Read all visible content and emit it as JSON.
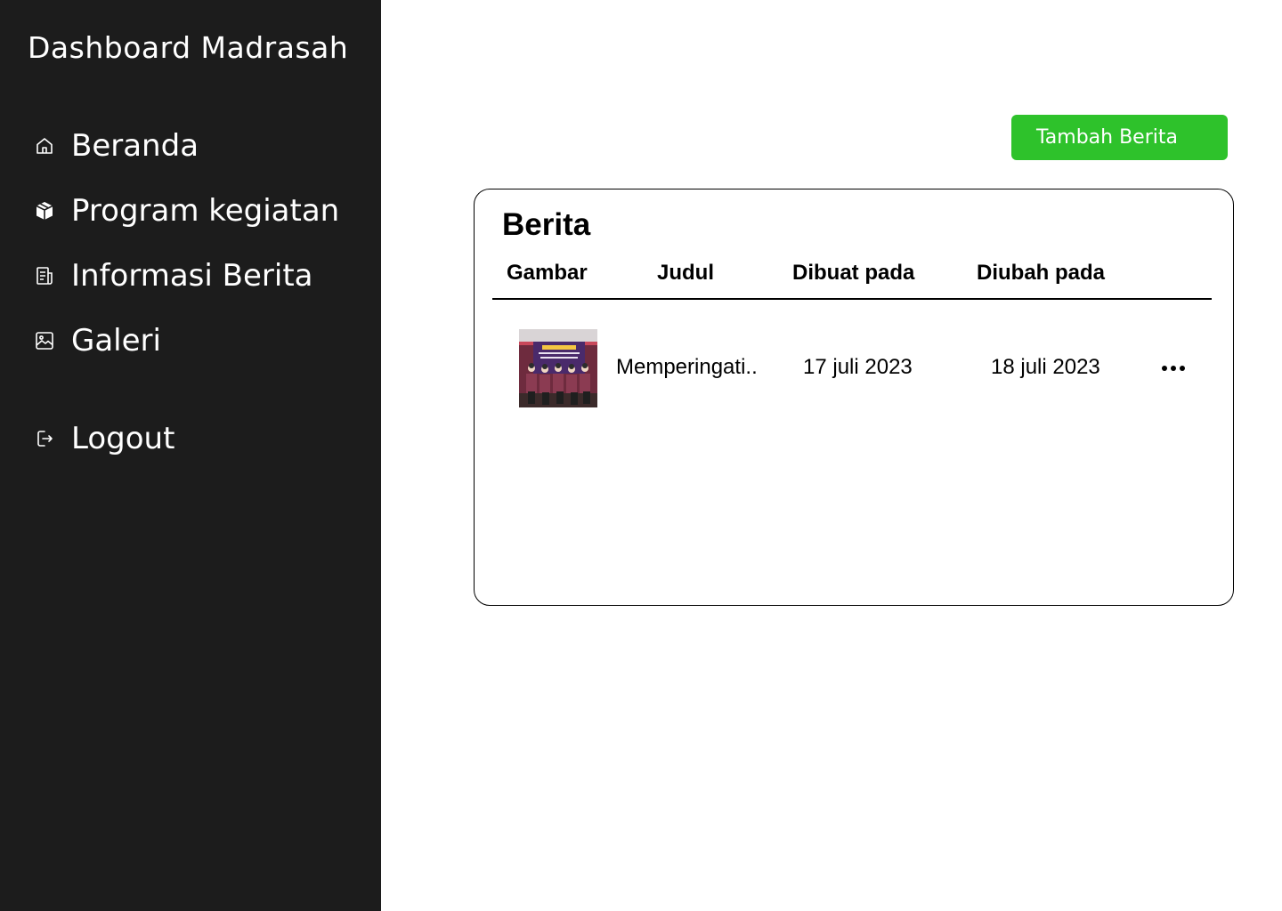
{
  "sidebar": {
    "title": "Dashboard Madrasah",
    "items": [
      {
        "label": "Beranda",
        "icon": "home-icon"
      },
      {
        "label": "Program kegiatan",
        "icon": "package-icon"
      },
      {
        "label": "Informasi Berita",
        "icon": "news-icon"
      },
      {
        "label": "Galeri",
        "icon": "image-icon"
      }
    ],
    "logout": {
      "label": "Logout",
      "icon": "logout-icon"
    }
  },
  "actions": {
    "add_news_label": "Tambah Berita",
    "add_news_color": "#2ec22b"
  },
  "table": {
    "title": "Berita",
    "columns": [
      "Gambar",
      "Judul",
      "Dibuat pada",
      "Diubah pada"
    ],
    "rows": [
      {
        "image_icon": "news-thumbnail",
        "title": "Memperingati..",
        "created": "17 juli 2023",
        "updated": "18 juli 2023",
        "menu_icon": "more-horizontal-icon"
      }
    ]
  },
  "colors": {
    "sidebar_bg": "#1c1c1c",
    "accent": "#2ec22b"
  }
}
